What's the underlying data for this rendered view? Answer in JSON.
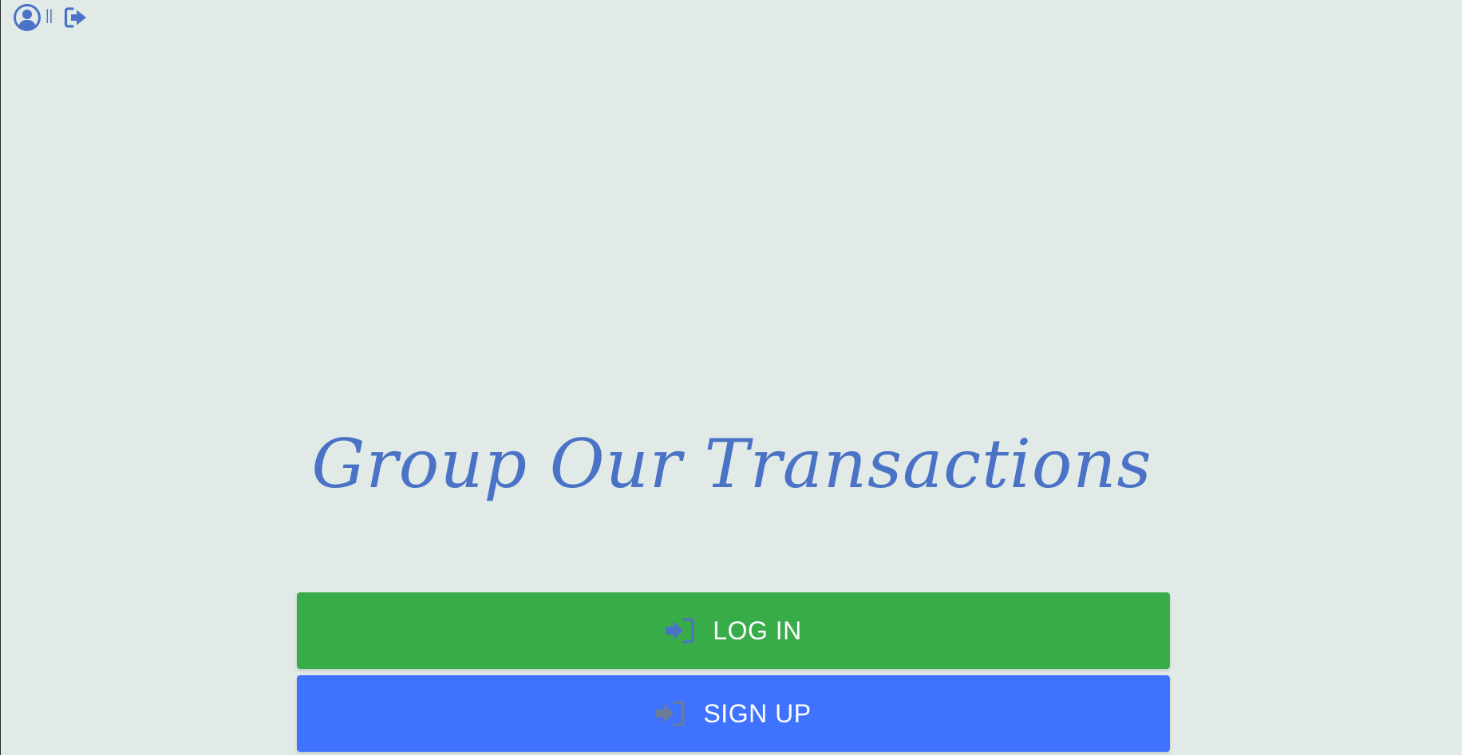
{
  "header": {
    "avatar_icon": "user-circle-icon",
    "separator": "||",
    "logout_icon": "sign-out-icon"
  },
  "main": {
    "title": "Group Our Transactions"
  },
  "buttons": {
    "login_label": "LOG IN",
    "login_icon": "sign-in-icon",
    "signup_label": "SIGN UP",
    "signup_icon": "sign-in-icon"
  },
  "colors": {
    "background": "#e2eae8",
    "accent": "#4a73c6",
    "login_button": "#38ac48",
    "signup_button": "#3f73ff",
    "button_icon_on_blue": "#6b7c9a"
  }
}
